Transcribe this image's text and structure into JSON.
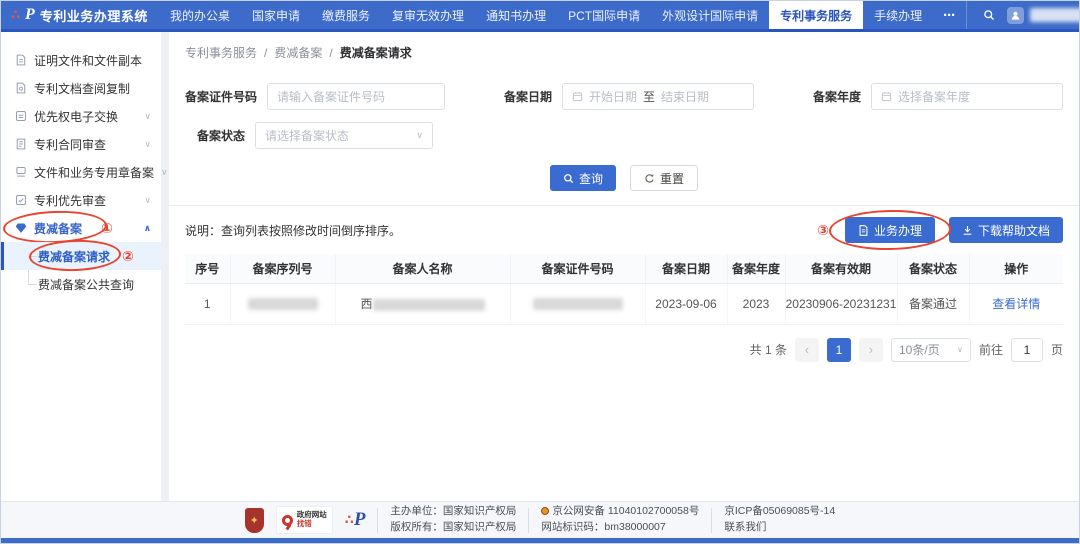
{
  "navbar": {
    "logo_title": "专利业务办理系统",
    "items": [
      {
        "label": "我的办公桌"
      },
      {
        "label": "国家申请"
      },
      {
        "label": "缴费服务"
      },
      {
        "label": "复审无效办理"
      },
      {
        "label": "通知书办理"
      },
      {
        "label": "PCT国际申请"
      },
      {
        "label": "外观设计国际申请"
      },
      {
        "label": "专利事务服务"
      },
      {
        "label": "手续办理"
      }
    ],
    "more_label": "⋯"
  },
  "sidebar": {
    "items": [
      {
        "label": "证明文件和文件副本"
      },
      {
        "label": "专利文档查阅复制"
      },
      {
        "label": "优先权电子交换"
      },
      {
        "label": "专利合同审查"
      },
      {
        "label": "文件和业务专用章备案"
      },
      {
        "label": "专利优先审查"
      },
      {
        "label": "费减备案",
        "children": [
          {
            "label": "费减备案请求"
          },
          {
            "label": "费减备案公共查询"
          }
        ]
      }
    ]
  },
  "annotations": {
    "step1": "①",
    "step2": "②",
    "step3": "③"
  },
  "breadcrumb": {
    "part1": "专利事务服务",
    "part2": "费减备案",
    "part3": "费减备案请求",
    "separator": "/"
  },
  "filters": {
    "cert": {
      "label": "备案证件号码",
      "placeholder": "请输入备案证件号码"
    },
    "date": {
      "label": "备案日期",
      "start_placeholder": "开始日期",
      "to_label": "至",
      "end_placeholder": "结束日期"
    },
    "year": {
      "label": "备案年度",
      "placeholder": "选择备案年度"
    },
    "status": {
      "label": "备案状态",
      "placeholder": "请选择备案状态"
    },
    "search_label": "查询",
    "reset_label": "重置"
  },
  "list_header": {
    "note": "说明：查询列表按照修改时间倒序排序。",
    "business_button": "业务办理",
    "download_button": "下载帮助文档"
  },
  "table": {
    "headers": [
      "序号",
      "备案序列号",
      "备案人名称",
      "备案证件号码",
      "备案日期",
      "备案年度",
      "备案有效期",
      "备案状态",
      "操作"
    ],
    "row": {
      "index": "1",
      "name_prefix": "西",
      "date": "2023-09-06",
      "year": "2023",
      "validity": "20230906-20231231",
      "status": "备案通过",
      "action": "查看详情"
    }
  },
  "pagination": {
    "total": "共 1 条",
    "prev": "‹",
    "page": "1",
    "next": "›",
    "size": "10条/页",
    "goto_label": "前往",
    "goto_value": "1",
    "page_unit": "页"
  },
  "footer": {
    "gov_badge_top": "政府网站",
    "gov_badge_bottom": "找错",
    "host": "主办单位：国家知识产权局",
    "copyright": "版权所有：国家知识产权局",
    "security": "京公网安备 11040102700058号",
    "site_code": "网站标识码：bm38000007",
    "icp": "京ICP备05069085号-14",
    "contact": "联系我们"
  },
  "colors": {
    "navbar_blue": "#3d6bc9",
    "accent_blue": "#3a6bd0",
    "active_item_bg": "#e9f2fd",
    "annotation_red": "#e8442e",
    "link_blue": "#3a6bd0"
  }
}
